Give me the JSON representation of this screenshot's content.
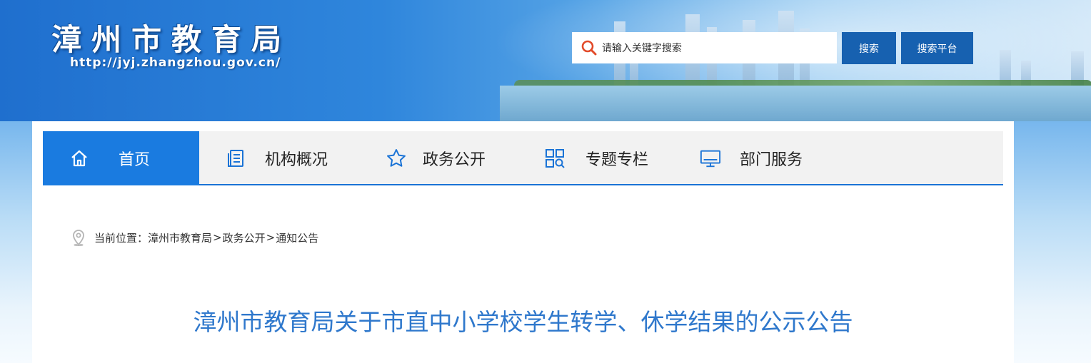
{
  "header": {
    "site_title": "漳州市教育局",
    "site_url": "http://jyj.zhangzhou.gov.cn/"
  },
  "search": {
    "placeholder": "请输入关键字搜索",
    "search_button": "搜索",
    "platform_button": "搜索平台"
  },
  "nav": {
    "items": [
      {
        "label": "首页",
        "icon": "home-icon",
        "active": true
      },
      {
        "label": "机构概况",
        "icon": "document-list-icon"
      },
      {
        "label": "政务公开",
        "icon": "star-icon"
      },
      {
        "label": "专题专栏",
        "icon": "grid-search-icon"
      },
      {
        "label": "部门服务",
        "icon": "monitor-icon"
      }
    ]
  },
  "breadcrumb": {
    "prefix": "当前位置：",
    "items": [
      "漳州市教育局",
      "政务公开",
      "通知公告"
    ],
    "separator": ">"
  },
  "article": {
    "title": "漳州市教育局关于市直中小学校学生转学、休学结果的公示公告"
  },
  "colors": {
    "nav_active": "#1a7be0",
    "button_bg": "#1761b0",
    "title_color": "#2f78cc"
  }
}
